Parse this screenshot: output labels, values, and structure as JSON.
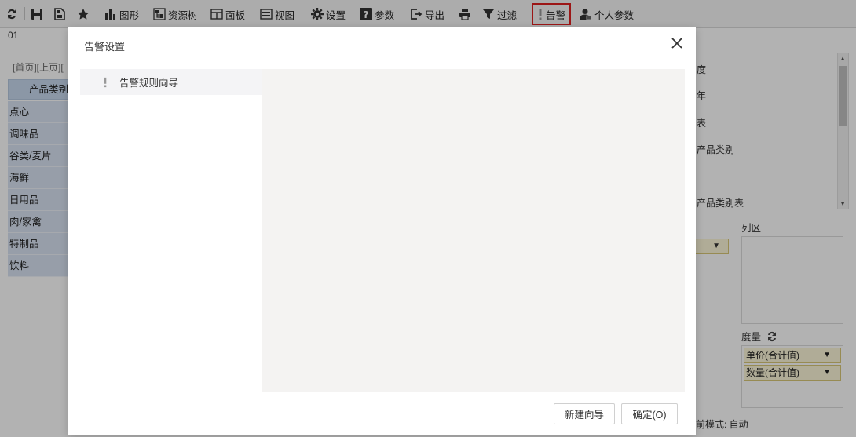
{
  "toolbar": {
    "chart": "图形",
    "resource_tree": "资源树",
    "panel": "面板",
    "view": "视图",
    "settings": "设置",
    "params": "参数",
    "export": "导出",
    "filter": "过滤",
    "alert": "告警",
    "personal_params": "个人参数"
  },
  "report": {
    "id": "01",
    "pager": "[首页][上页][",
    "category_header": "产品类别",
    "categories": [
      "点心",
      "调味品",
      "谷类/麦片",
      "海鲜",
      "日用品",
      "肉/家禽",
      "特制品",
      "饮料"
    ]
  },
  "right_panel": {
    "tree_items": [
      "度",
      "年",
      "表",
      "产品类别",
      "产品类别表"
    ],
    "column_area": "列区",
    "measure": "度量",
    "measures": [
      "单价(合计值)",
      "数量(合计值)"
    ],
    "mode": "前模式: 自动"
  },
  "dialog": {
    "title": "告警设置",
    "nav_item": "告警规则向导",
    "btn_new": "新建向导",
    "btn_ok": "确定(O)"
  },
  "colors": {
    "alert_highlight": "#e02020",
    "category_bg": "#d8e3f2",
    "field_bg": "#fdf6d8"
  }
}
